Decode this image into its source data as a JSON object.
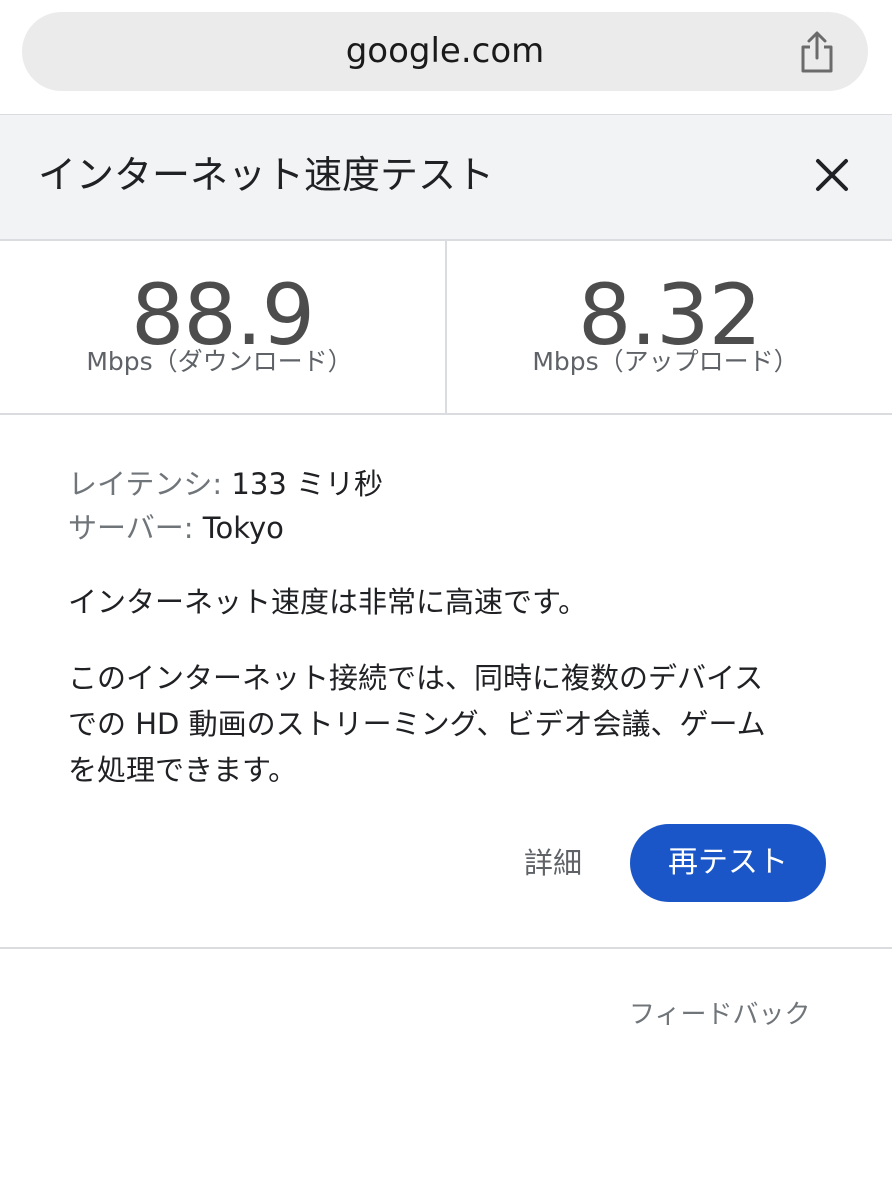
{
  "browser": {
    "url": "google.com",
    "share_icon": "share-icon"
  },
  "dialog": {
    "title": "インターネット速度テスト",
    "close_icon": "close-icon"
  },
  "metrics": {
    "download": {
      "value": "88.9",
      "unit": "Mbps（ダウンロード）"
    },
    "upload": {
      "value": "8.32",
      "unit": "Mbps（アップロード）"
    }
  },
  "info": {
    "latency_label": "レイテンシ:",
    "latency_value": "133 ミリ秒",
    "server_label": "サーバー:",
    "server_value": "Tokyo"
  },
  "summary": "インターネット速度は非常に高速です。",
  "description": {
    "line1": "このインターネット接続では、同時に複数のデバイス",
    "line2": "での HD 動画のストリーミング、ビデオ会議、ゲーム",
    "line3": "を処理できます。"
  },
  "actions": {
    "details_label": "詳細",
    "retest_label": "再テスト"
  },
  "footer": {
    "feedback_label": "フィードバック"
  },
  "colors": {
    "retest_button": "#1a56c7",
    "header_background": "#f1f3f4",
    "url_bar_background": "#ebebeb"
  }
}
